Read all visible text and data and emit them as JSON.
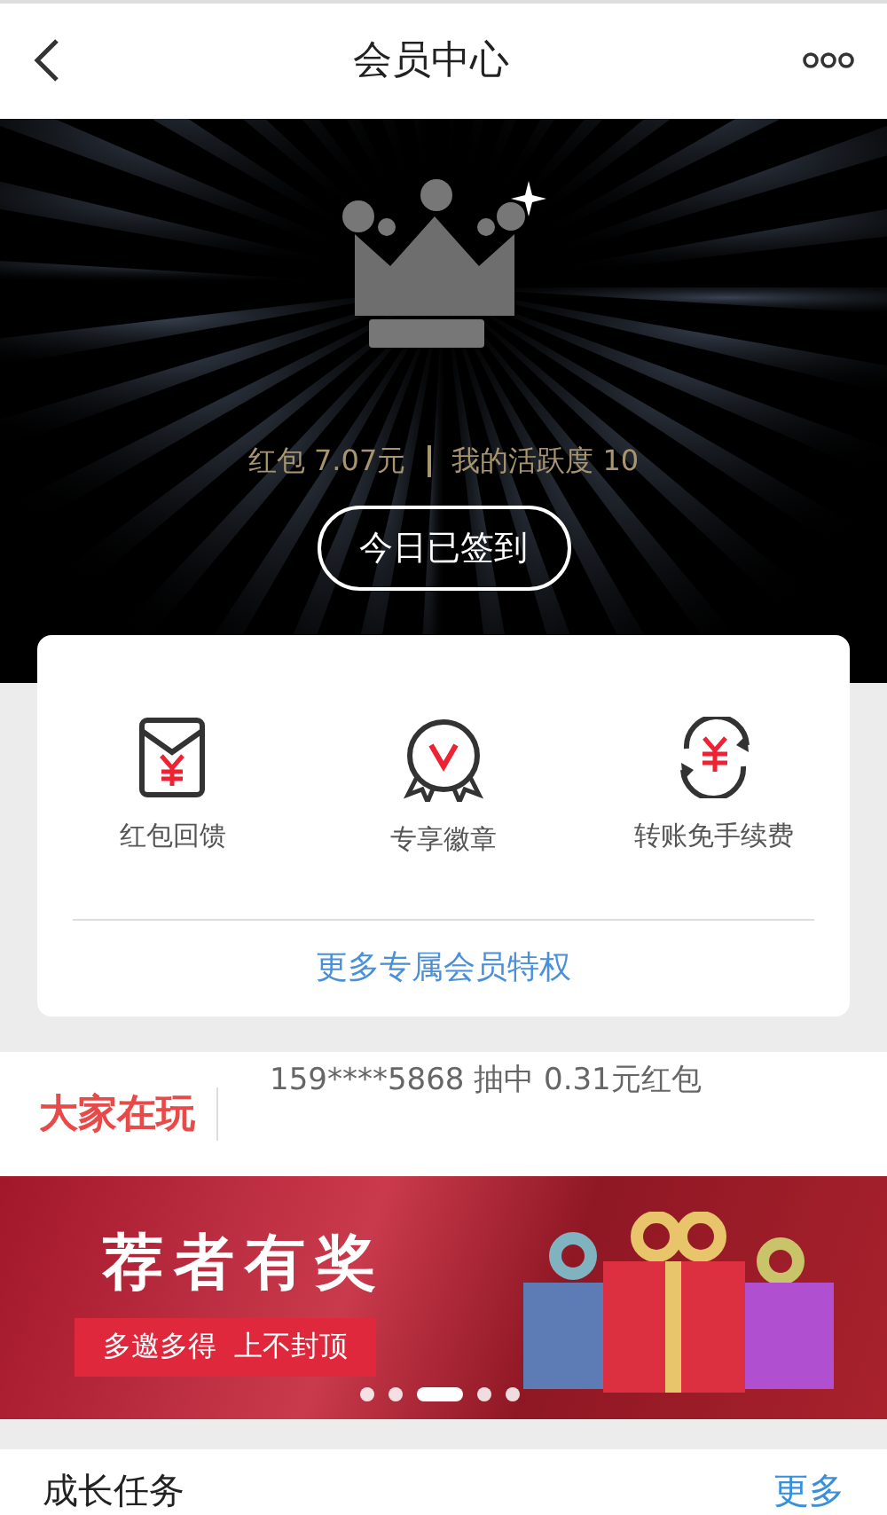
{
  "header": {
    "title": "会员中心"
  },
  "hero": {
    "balance": "红包 7.07元",
    "activity": "我的活跃度 10",
    "checkin_button": "今日已签到"
  },
  "perks": {
    "items": [
      {
        "kind": "envelope",
        "label": "红包回馈"
      },
      {
        "kind": "badge",
        "label": "专享徽章"
      },
      {
        "kind": "transfer",
        "label": "转账免手续费"
      }
    ],
    "more_link": "更多专属会员特权"
  },
  "ticker": {
    "title": "大家在玩",
    "messages": [
      "159****5868 抽中 0.31元红包"
    ]
  },
  "banner": {
    "headline": "荐者有奖",
    "ribbon": "多邀多得  上不封顶",
    "dots": [
      {
        "selected": false
      },
      {
        "selected": false
      },
      {
        "selected": true
      },
      {
        "selected": false
      },
      {
        "selected": false
      }
    ]
  },
  "section": {
    "title": "成长任务",
    "more": "更多"
  }
}
